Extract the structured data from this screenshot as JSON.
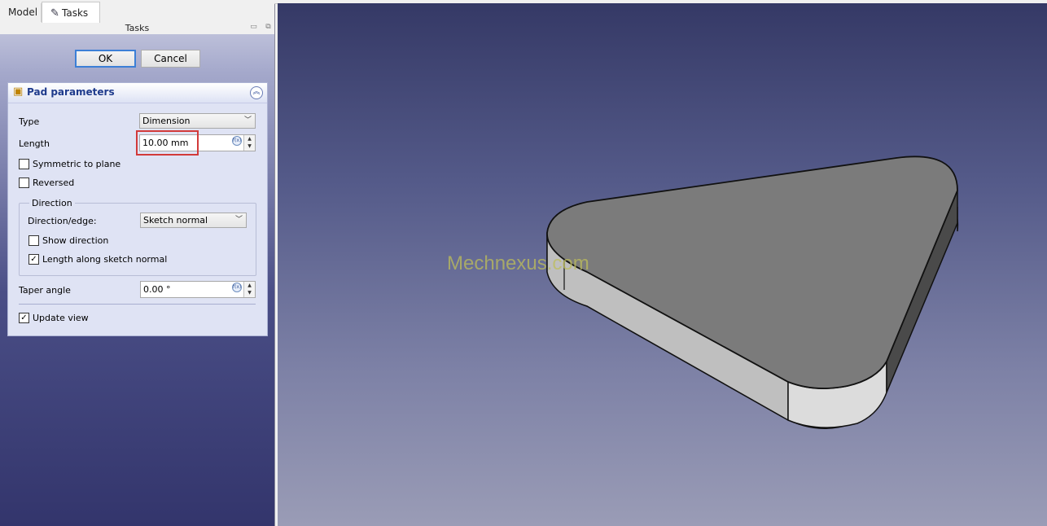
{
  "tabs": {
    "model": "Model",
    "tasks": "Tasks"
  },
  "panel": {
    "title": "Tasks"
  },
  "buttons": {
    "ok": "OK",
    "cancel": "Cancel"
  },
  "pad": {
    "title": "Pad parameters",
    "type_label": "Type",
    "type_value": "Dimension",
    "length_label": "Length",
    "length_value": "10.00 mm",
    "symmetric_label": "Symmetric to plane",
    "symmetric_checked": false,
    "reversed_label": "Reversed",
    "reversed_checked": false,
    "direction_group": "Direction",
    "direction_edge_label": "Direction/edge:",
    "direction_edge_value": "Sketch normal",
    "show_direction_label": "Show direction",
    "show_direction_checked": false,
    "length_along_label": "Length along sketch normal",
    "length_along_checked": true,
    "taper_label": "Taper angle",
    "taper_value": "0.00 °",
    "update_view_label": "Update view",
    "update_view_checked": true
  },
  "viewport": {
    "watermark": "Mechnexus.com"
  },
  "colors": {
    "accent_ok": "#3c7fd6",
    "highlight_red": "#d23a3a",
    "shape_top": "#7a7a7a",
    "shape_side_light": "#d8d8d8",
    "shape_side_dark": "#4a4a4a"
  }
}
